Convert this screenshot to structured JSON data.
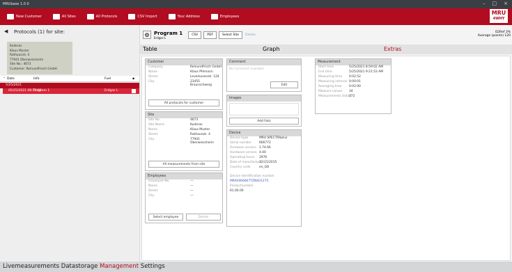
{
  "window": {
    "title": "MRUbase 1.0.0"
  },
  "toolbar": {
    "items": [
      "New Customer",
      "All Sites",
      "All Protocols",
      "CSV Import",
      "Your Address",
      "Employees"
    ]
  },
  "logo": {
    "line1": "MRU",
    "line2": "4WHY"
  },
  "left": {
    "title": "Protocols (1) for site:",
    "info": [
      "Kuderas",
      "Klaus Muster",
      "Rathausstr. 4",
      "77941 Oberweissheim",
      "Site No.: 4673",
      "Customer: Reinundfrisch GmbH"
    ],
    "columns": {
      "date": "Date",
      "info": "Info",
      "fuel": "Fuel"
    },
    "group": "5/25/2021",
    "row": {
      "date": "05/25/2021 08:55:09",
      "info": "Program 1",
      "fuel": "Erdgas L"
    }
  },
  "program": {
    "name": "Program 1",
    "fuel": "Erdgas L",
    "o2ref": "O2Ref 3%",
    "avg": "Average (points) 120"
  },
  "buttons": {
    "csv": "CSV",
    "pdf": "PDF",
    "select_site": "Select Site",
    "delete": "Delete"
  },
  "tabs": {
    "table": "Table",
    "graph": "Graph",
    "extras": "Extras"
  },
  "customer": {
    "title": "Customer",
    "company_k": "Company",
    "company": "Reinundfrisch GmbH",
    "name_k": "Name",
    "name": "Klaus   Pfemann",
    "street_k": "Street",
    "street": "Leverkusenstr.  124",
    "city_k": "City",
    "city": "23455  Braunschweig",
    "btn": "All protocols for customer"
  },
  "site": {
    "title": "Site",
    "siteno_k": "Site No.",
    "siteno": "4673",
    "sitename_k": "Site Name",
    "sitename": "Kuderas",
    "name_k": "Name",
    "name": "Klaus   Muster",
    "street_k": "Street",
    "street": "Rathausstr.  4",
    "city_k": "City",
    "city": "77941  Oberweissheim",
    "btn": "All measurements from site"
  },
  "employees": {
    "title": "Employees",
    "empno_k": "Employee-No.",
    "empno": "---",
    "name_k": "Name",
    "name": "---",
    "street_k": "Street",
    "street": "---",
    "city_k": "City",
    "city": "---",
    "select": "Select employee",
    "delete": "Delete"
  },
  "comment": {
    "title": "Comment",
    "placeholder": "No Comment available",
    "edit": "Edit"
  },
  "images": {
    "title": "Images",
    "add": "Add Foto"
  },
  "device": {
    "title": "Device",
    "type_k": "Device type",
    "type": "MRU SPECTRAplus",
    "serial_k": "Serial number",
    "serial": "666772",
    "fw_k": "Firmware version",
    "fw": "1.74.66",
    "hw_k": "Hardware version",
    "hw": "4.00",
    "hours_k": "Operating hours",
    "hours": "2976",
    "mfg_k": "Date of manufacture",
    "mfg": "12/21/2015",
    "country_k": "Country code",
    "country": "en_GB",
    "ident_k": "Device Identification number",
    "ident": "MRAV066667TZN4U1275",
    "prod_k": "Productnumber",
    "prod": "61.00.00"
  },
  "measurement": {
    "title": "Measurement",
    "start_k": "Start time",
    "start": "5/25/2021 8:59:02 AM",
    "end_k": "End time",
    "end": "5/25/2021 9:21:53 AM",
    "mtime_k": "Measuring time",
    "mtime": "0:02:52",
    "interval_k": "Measuring interval",
    "interval": "0:00:01",
    "avg_k": "Averaging time",
    "avg": "0:02:00",
    "vals_k": "Measure values",
    "vals": "34",
    "total_k": "Measurements (total)",
    "total": "172"
  },
  "status": {
    "items": [
      "Livemeasurements",
      "Datastorage",
      "Management",
      "Settings"
    ]
  }
}
